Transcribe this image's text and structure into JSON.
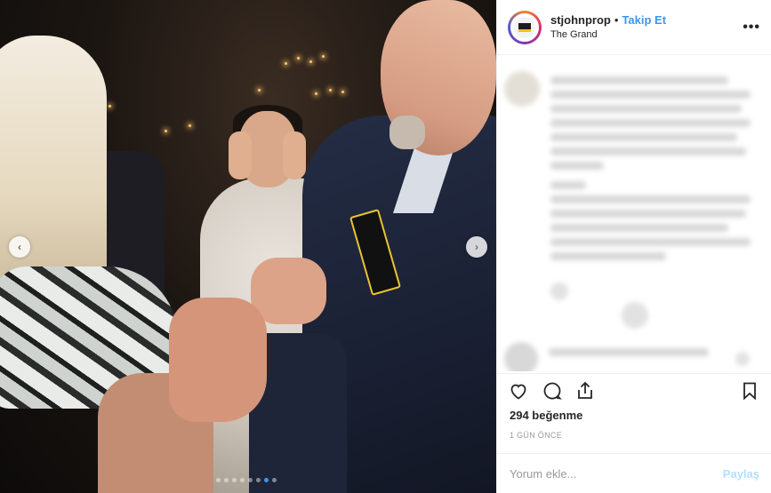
{
  "header": {
    "username": "stjohnprop",
    "separator": "•",
    "follow_label": "Takip Et",
    "location": "The Grand",
    "more_icon": "more-horizontal-icon"
  },
  "carousel": {
    "prev_icon": "chevron-left-icon",
    "next_icon": "chevron-right-icon",
    "prev_glyph": "‹",
    "next_glyph": "›",
    "slide_count": 8,
    "active_index": 6,
    "active_color": "#3897f0"
  },
  "actions": {
    "like_icon": "heart-icon",
    "comment_icon": "comment-icon",
    "share_icon": "share-icon",
    "save_icon": "bookmark-icon"
  },
  "likes_text": "294 beğenme",
  "timestamp": "1 GÜN ÖNCE",
  "comment_box": {
    "placeholder": "Yorum ekle...",
    "post_label": "Paylaş"
  },
  "colors": {
    "link_blue": "#3897f0",
    "post_button_disabled": "#b2dffc",
    "muted_text": "#999999",
    "border": "#efefef"
  }
}
